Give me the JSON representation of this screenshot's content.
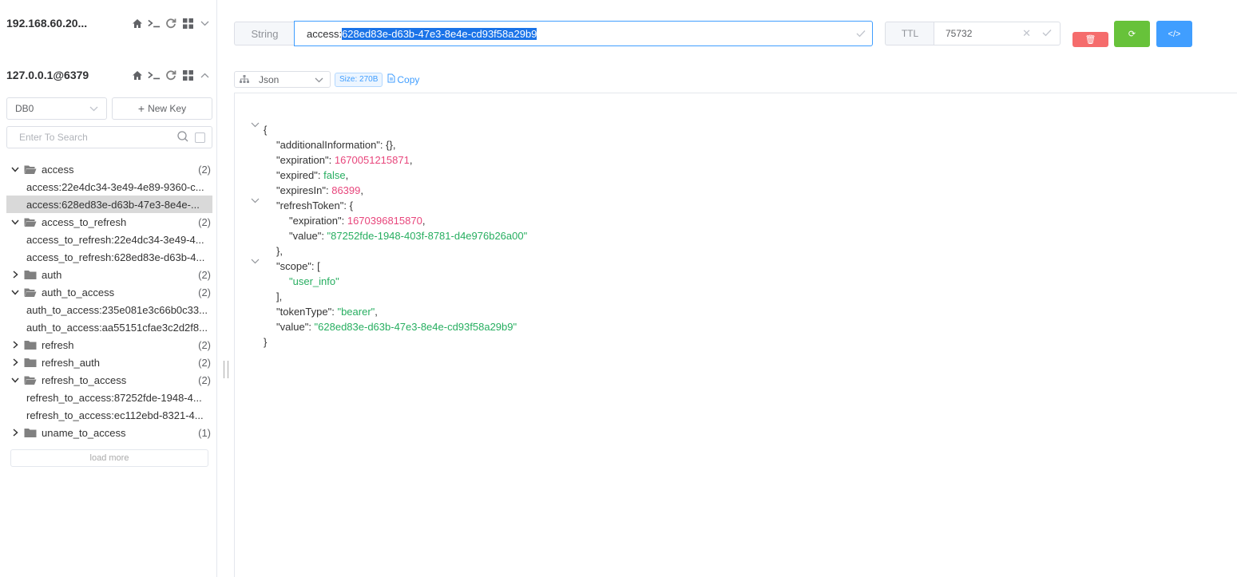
{
  "connections": [
    {
      "name": "192.168.60.20...",
      "expanded": false
    },
    {
      "name": "127.0.0.1@6379",
      "expanded": true
    }
  ],
  "db_select": "DB0",
  "new_key_label": "New Key",
  "search_placeholder": "Enter To Search",
  "tree": [
    {
      "type": "folder",
      "label": "access",
      "count": "(2)",
      "open": true
    },
    {
      "type": "key",
      "label": "access:22e4dc34-3e49-4e89-9360-c..."
    },
    {
      "type": "key",
      "label": "access:628ed83e-d63b-47e3-8e4e-...",
      "selected": true
    },
    {
      "type": "folder",
      "label": "access_to_refresh",
      "count": "(2)",
      "open": true
    },
    {
      "type": "key",
      "label": "access_to_refresh:22e4dc34-3e49-4..."
    },
    {
      "type": "key",
      "label": "access_to_refresh:628ed83e-d63b-4..."
    },
    {
      "type": "folder",
      "label": "auth",
      "count": "(2)",
      "open": false
    },
    {
      "type": "folder",
      "label": "auth_to_access",
      "count": "(2)",
      "open": true
    },
    {
      "type": "key",
      "label": "auth_to_access:235e081e3c66b0c33..."
    },
    {
      "type": "key",
      "label": "auth_to_access:aa55151cfae3c2d2f8..."
    },
    {
      "type": "folder",
      "label": "refresh",
      "count": "(2)",
      "open": false
    },
    {
      "type": "folder",
      "label": "refresh_auth",
      "count": "(2)",
      "open": false
    },
    {
      "type": "folder",
      "label": "refresh_to_access",
      "count": "(2)",
      "open": true
    },
    {
      "type": "key",
      "label": "refresh_to_access:87252fde-1948-4..."
    },
    {
      "type": "key",
      "label": "refresh_to_access:ec112ebd-8321-4..."
    },
    {
      "type": "folder",
      "label": "uname_to_access",
      "count": "(1)",
      "open": false
    }
  ],
  "load_more": "load more",
  "key_type": "String",
  "key_prefix": "access:",
  "key_selected": "628ed83e-d63b-47e3-8e4e-cd93f58a29b9",
  "ttl_label": "TTL",
  "ttl_value": "75732",
  "format": "Json",
  "size": "Size: 270B",
  "copy_label": "Copy",
  "json": {
    "k_additional": "\"additionalInformation\"",
    "v_additional": "{},",
    "k_expiration": "\"expiration\"",
    "v_expiration": "1670051215871",
    "k_expired": "\"expired\"",
    "v_expired": "false",
    "k_expiresIn": "\"expiresIn\"",
    "v_expiresIn": "86399",
    "k_refreshToken": "\"refreshToken\"",
    "k_rt_expiration": "\"expiration\"",
    "v_rt_expiration": "1670396815870",
    "k_rt_value": "\"value\"",
    "v_rt_value": "\"87252fde-1948-403f-8781-d4e976b26a00\"",
    "k_scope": "\"scope\"",
    "v_scope0": "\"user_info\"",
    "k_tokenType": "\"tokenType\"",
    "v_tokenType": "\"bearer\"",
    "k_value": "\"value\"",
    "v_value": "\"628ed83e-d63b-47e3-8e4e-cd93f58a29b9\""
  },
  "colors": {
    "accent": "#409eff",
    "number": "#e8467c",
    "string": "#27ae60",
    "delete": "#f56c6c",
    "refresh": "#67c23a"
  }
}
